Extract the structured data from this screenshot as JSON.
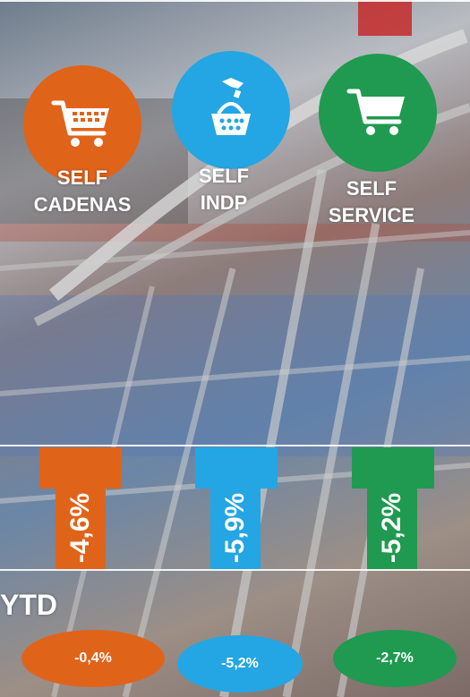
{
  "colors": {
    "orange": "#e0631a",
    "blue": "#23a6e3",
    "green": "#1f9a50",
    "white": "#ffffff"
  },
  "categories": [
    {
      "label_line1": "SELF",
      "label_line2": "CADENAS",
      "icon": "shopping-cart-icon",
      "monthly_change": "-4,6%",
      "ytd_change": "-0,4%"
    },
    {
      "label_line1": "SELF",
      "label_line2": "INDP",
      "icon": "basket-hand-icon",
      "monthly_change": "-5,9%",
      "ytd_change": "-5,2%"
    },
    {
      "label_line1": "SELF",
      "label_line2": "SERVICE",
      "icon": "cart-icon",
      "monthly_change": "-5,2%",
      "ytd_change": "-2,7%"
    }
  ],
  "ytd_label": "YTD"
}
